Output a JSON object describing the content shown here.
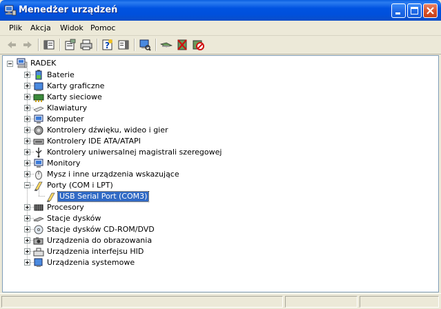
{
  "window": {
    "title": "Menedżer urządzeń"
  },
  "menu": {
    "items": [
      "Plik",
      "Akcja",
      "Widok",
      "Pomoc"
    ]
  },
  "toolbar": {
    "buttons": [
      {
        "name": "back-arrow-icon",
        "enabled": false
      },
      {
        "name": "forward-arrow-icon",
        "enabled": false
      },
      {
        "name": "show-hide-console-tree-icon"
      },
      {
        "name": "properties-icon"
      },
      {
        "name": "print-icon"
      },
      {
        "name": "help-icon"
      },
      {
        "name": "show-hide-action-pane-icon"
      },
      {
        "name": "scan-hardware-changes-icon"
      },
      {
        "name": "update-driver-icon"
      },
      {
        "name": "uninstall-icon"
      },
      {
        "name": "disable-icon"
      }
    ]
  },
  "tree": {
    "root": {
      "label": "RADEK",
      "icon": "computer-icon",
      "expanded": true
    },
    "nodes": [
      {
        "label": "Baterie",
        "icon": "battery-icon",
        "expanded": false
      },
      {
        "label": "Karty graficzne",
        "icon": "display-adapter-icon",
        "expanded": false
      },
      {
        "label": "Karty sieciowe",
        "icon": "network-adapter-icon",
        "expanded": false
      },
      {
        "label": "Klawiatury",
        "icon": "keyboard-icon",
        "expanded": false
      },
      {
        "label": "Komputer",
        "icon": "computer-monitor-icon",
        "expanded": false
      },
      {
        "label": "Kontrolery dźwięku, wideo i gier",
        "icon": "sound-icon",
        "expanded": false
      },
      {
        "label": "Kontrolery IDE ATA/ATAPI",
        "icon": "ide-controller-icon",
        "expanded": false
      },
      {
        "label": "Kontrolery uniwersalnej magistrali szeregowej",
        "icon": "usb-icon",
        "expanded": false
      },
      {
        "label": "Monitory",
        "icon": "monitor-icon",
        "expanded": false
      },
      {
        "label": "Mysz i inne urządzenia wskazujące",
        "icon": "mouse-icon",
        "expanded": false
      },
      {
        "label": "Porty (COM i LPT)",
        "icon": "port-icon",
        "expanded": true,
        "children": [
          {
            "label": "USB Serial Port (COM3)",
            "icon": "port-icon",
            "selected": true
          }
        ]
      },
      {
        "label": "Procesory",
        "icon": "processor-icon",
        "expanded": false
      },
      {
        "label": "Stacje dysków",
        "icon": "disk-drive-icon",
        "expanded": false
      },
      {
        "label": "Stacje dysków CD-ROM/DVD",
        "icon": "cdrom-icon",
        "expanded": false
      },
      {
        "label": "Urządzenia do obrazowania",
        "icon": "camera-icon",
        "expanded": false
      },
      {
        "label": "Urządzenia interfejsu HID",
        "icon": "hid-icon",
        "expanded": false
      },
      {
        "label": "Urządzenia systemowe",
        "icon": "system-device-icon",
        "expanded": false
      }
    ]
  },
  "colors": {
    "titlebar": "#0054e3",
    "selection": "#316ac5",
    "chrome": "#ece9d8"
  }
}
